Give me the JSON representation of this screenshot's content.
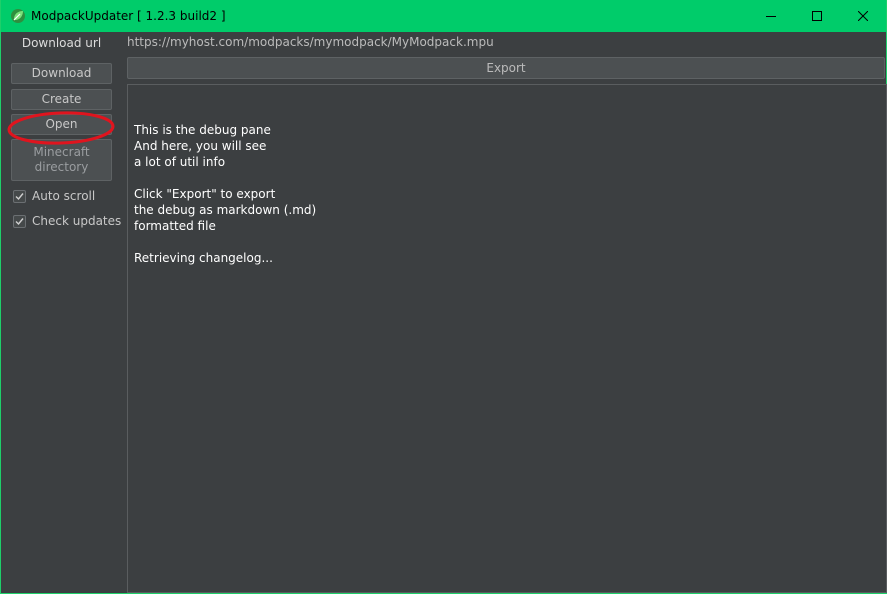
{
  "window": {
    "title": "ModpackUpdater [ 1.2.3 build2 ]",
    "accent_color": "#00cc6a",
    "buttons": {
      "minimize_icon": "minimize-icon",
      "maximize_icon": "maximize-icon",
      "close_icon": "close-icon"
    }
  },
  "sidebar": {
    "download_url_label": "Download url",
    "buttons": {
      "download": "Download",
      "create": "Create",
      "open": "Open",
      "minecraft_directory_line1": "Minecraft",
      "minecraft_directory_line2": "directory"
    },
    "checkboxes": [
      {
        "label": "Auto scroll",
        "checked": true
      },
      {
        "label": "Check updates",
        "checked": true
      }
    ]
  },
  "url": {
    "value": "https://myhost.com/modpacks/mymodpack/MyModpack.mpu"
  },
  "export": {
    "label": "Export"
  },
  "debug": {
    "lines": [
      "This is the debug pane",
      "And here, you will see",
      "a lot of util info",
      "",
      "Click \"Export\" to export",
      "the debug as markdown (.md)",
      "formatted file",
      "",
      "Retrieving changelog..."
    ]
  },
  "annotation": {
    "color": "#e0141e",
    "target": "Open"
  }
}
